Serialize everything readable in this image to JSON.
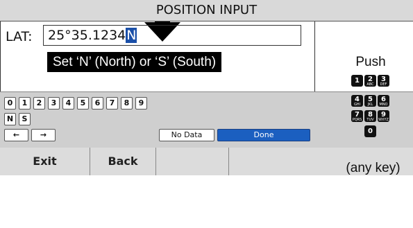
{
  "screen": {
    "title": "POSITION INPUT",
    "lat_label": "LAT:",
    "lat_value": "25°35.1234",
    "lat_cursor_char": "N",
    "hint": "Set ‘N’ (North) or ‘S’ (South)",
    "keypad_row1": [
      "0",
      "1",
      "2",
      "3",
      "4",
      "5",
      "6",
      "7",
      "8",
      "9"
    ],
    "keypad_row2": [
      "N",
      "S"
    ],
    "keypad_row3": {
      "left_arrow": "←",
      "right_arrow": "→",
      "no_data": "No Data",
      "done": "Done"
    },
    "softkeys": [
      "Exit",
      "Back",
      "",
      ""
    ]
  },
  "side": {
    "push_label": "Push",
    "any_key_label": "(any key)",
    "keys": [
      {
        "digit": "1",
        "letters": ""
      },
      {
        "digit": "2",
        "letters": "ABC"
      },
      {
        "digit": "3",
        "letters": "DEF"
      },
      {
        "digit": "4",
        "letters": "GHI"
      },
      {
        "digit": "5",
        "letters": "JKL"
      },
      {
        "digit": "6",
        "letters": "MNO"
      },
      {
        "digit": "7",
        "letters": "PQRS"
      },
      {
        "digit": "8",
        "letters": "TUV"
      },
      {
        "digit": "9",
        "letters": "WXYZ"
      },
      {
        "digit": "0",
        "letters": ""
      }
    ]
  },
  "colors": {
    "done_button": "#1b5fc0",
    "cursor_highlight": "#1a4fa8",
    "title_bar": "#d9d9d9",
    "keypad_bg": "#cfcfcf"
  },
  "icons": {
    "top_arrow": "down-arrow-icon"
  }
}
